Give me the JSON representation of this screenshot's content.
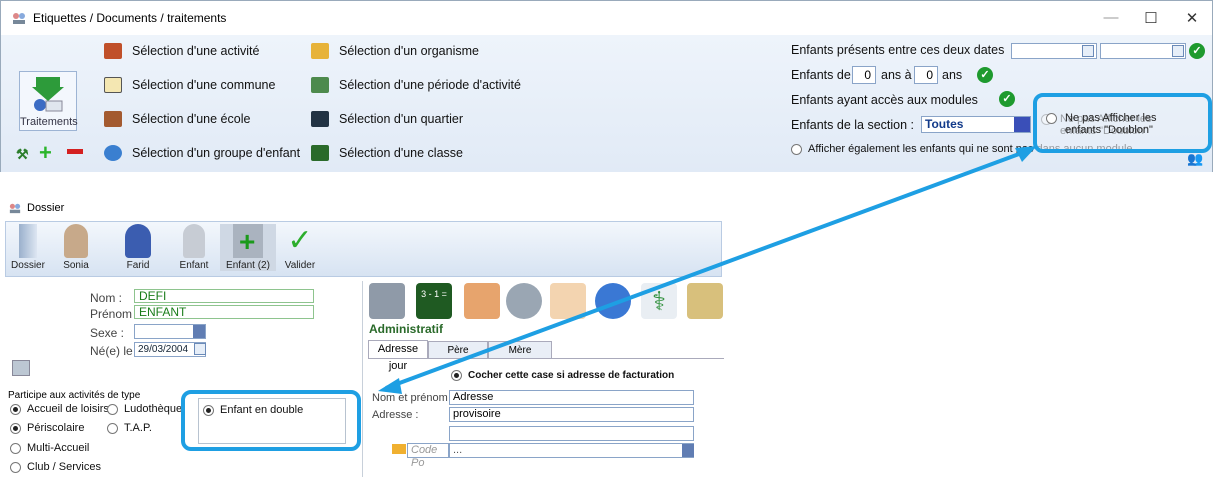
{
  "window": {
    "title": "Etiquettes / Documents / traitements",
    "min_label": "—",
    "max_label": "☐",
    "close_label": "✕"
  },
  "toolbar": {
    "traitements_label": "Traitements",
    "selections": [
      "Sélection d'une activité",
      "Sélection d'une commune",
      "Sélection d'une école",
      "Sélection d'un groupe d'enfant",
      "Sélection d'un organisme",
      "Sélection d'une période d'activité",
      "Sélection d'un quartier",
      "Sélection d'une classe"
    ],
    "filters": {
      "dates_label": "Enfants présents entre ces deux dates",
      "age_from_label": "Enfants de",
      "age_from": "0",
      "age_mid_label": "ans à",
      "age_to": "0",
      "age_to_label": "ans",
      "modules_label": "Enfants ayant accès aux modules",
      "section_label": "Enfants de la section :",
      "section_value": "Toutes",
      "also_label": "Afficher également les enfants qui ne sont pas dans aucun module",
      "doublon_label_1": "Ne pas Afficher les",
      "doublon_label_2": "enfants \"Doublon\""
    }
  },
  "dossier": {
    "title": "Dossier",
    "toolbar": [
      "Dossier",
      "Sonia",
      "Farid",
      "Enfant",
      "Enfant (2)",
      "Valider"
    ],
    "form": {
      "nom_label": "Nom :",
      "nom": "DEFI",
      "prenom_label": "Prénom :",
      "prenom": "ENFANT",
      "sexe_label": "Sexe :",
      "naissance_label": "Né(e) le :",
      "naissance": "29/03/2004"
    },
    "participe_label": "Participe aux activités de type",
    "activites": [
      {
        "label": "Accueil de loisirs",
        "on": true
      },
      {
        "label": "Ludothèque",
        "on": false
      },
      {
        "label": "Périscolaire",
        "on": true
      },
      {
        "label": "T.A.P.",
        "on": false
      },
      {
        "label": "Multi-Accueil",
        "on": false
      },
      {
        "label": "Club / Services",
        "on": false
      }
    ],
    "doublon_label": "Enfant en double",
    "section_title": "Administratif",
    "tabs": [
      "Adresse jour",
      "Père",
      "Mère"
    ],
    "facturation_label": "Cocher cette case si adresse de facturation",
    "nom_prenom_label": "Nom et prénom",
    "nom_prenom": "Adresse",
    "adresse_label": "Adresse :",
    "adresse": "provisoire",
    "code_postal_placeholder": "Code Po",
    "ville_value": "..."
  },
  "colors": {
    "highlight": "#1e9fe3",
    "check": "#1e9a2e"
  }
}
